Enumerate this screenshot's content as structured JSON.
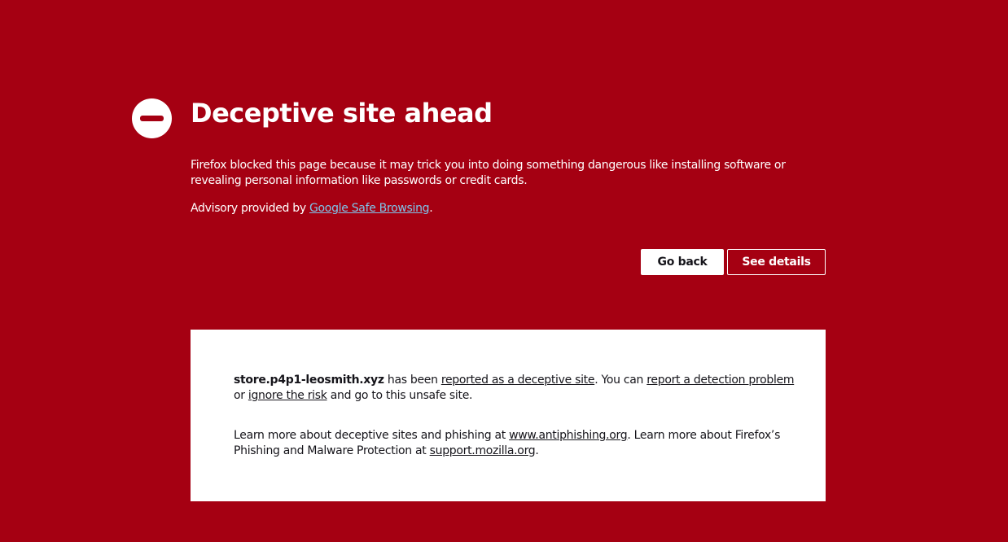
{
  "colors": {
    "background": "#a50012",
    "panel": "#ffffff",
    "link_on_red": "#7fc4ea",
    "text_dark": "#15141a"
  },
  "icon": {
    "name": "block-icon"
  },
  "title": "Deceptive site ahead",
  "description": "Firefox blocked this page because it may trick you into doing something dangerous like installing software or revealing personal information like passwords or credit cards.",
  "advisory": {
    "prefix": "Advisory provided by ",
    "link_label": "Google Safe Browsing",
    "suffix": "."
  },
  "buttons": {
    "go_back": "Go back",
    "see_details": "See details"
  },
  "details": {
    "domain": "store.p4p1-leosmith.xyz",
    "text1": " has been ",
    "link_reported": "reported as a deceptive site",
    "text2": ". You can ",
    "link_report_problem": "report a detection problem",
    "text3": " or ",
    "link_ignore": "ignore the risk",
    "text4": " and go to this unsafe site.",
    "learn_prefix": "Learn more about deceptive sites and phishing at ",
    "link_antiphishing": "www.antiphishing.org",
    "learn_middle": ". Learn more about Firefox’s Phishing and Malware Protection at ",
    "link_support": "support.mozilla.org",
    "learn_suffix": "."
  }
}
